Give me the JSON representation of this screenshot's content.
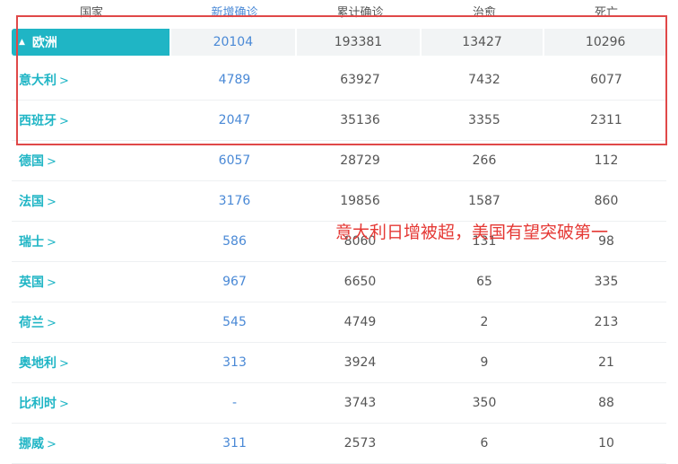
{
  "header": {
    "country": "国家",
    "new_confirmed": "新增确诊",
    "total_confirmed": "累计确诊",
    "recovered": "治愈",
    "deaths": "死亡"
  },
  "summary": {
    "region": "欧洲",
    "new_confirmed": "20104",
    "total_confirmed": "193381",
    "recovered": "13427",
    "deaths": "10296"
  },
  "rows": [
    {
      "name": "意大利",
      "new": "4789",
      "total": "63927",
      "recovered": "7432",
      "deaths": "6077"
    },
    {
      "name": "西班牙",
      "new": "2047",
      "total": "35136",
      "recovered": "3355",
      "deaths": "2311"
    },
    {
      "name": "德国",
      "new": "6057",
      "total": "28729",
      "recovered": "266",
      "deaths": "112"
    },
    {
      "name": "法国",
      "new": "3176",
      "total": "19856",
      "recovered": "1587",
      "deaths": "860"
    },
    {
      "name": "瑞士",
      "new": "586",
      "total": "8060",
      "recovered": "131",
      "deaths": "98"
    },
    {
      "name": "英国",
      "new": "967",
      "total": "6650",
      "recovered": "65",
      "deaths": "335"
    },
    {
      "name": "荷兰",
      "new": "545",
      "total": "4749",
      "recovered": "2",
      "deaths": "213"
    },
    {
      "name": "奥地利",
      "new": "313",
      "total": "3924",
      "recovered": "9",
      "deaths": "21"
    },
    {
      "name": "比利时",
      "new": "-",
      "total": "3743",
      "recovered": "350",
      "deaths": "88"
    },
    {
      "name": "挪威",
      "new": "311",
      "total": "2573",
      "recovered": "6",
      "deaths": "10"
    }
  ],
  "annotation": "意大利日增被超，美国有望突破第一",
  "icons": {
    "expand": "caret-up-icon",
    "row_arrow": "chevron-right-icon"
  },
  "colors": {
    "accent": "#1fb5c5",
    "new_value": "#4a89d6",
    "highlight": "#e04848",
    "annotation": "#e53935"
  }
}
